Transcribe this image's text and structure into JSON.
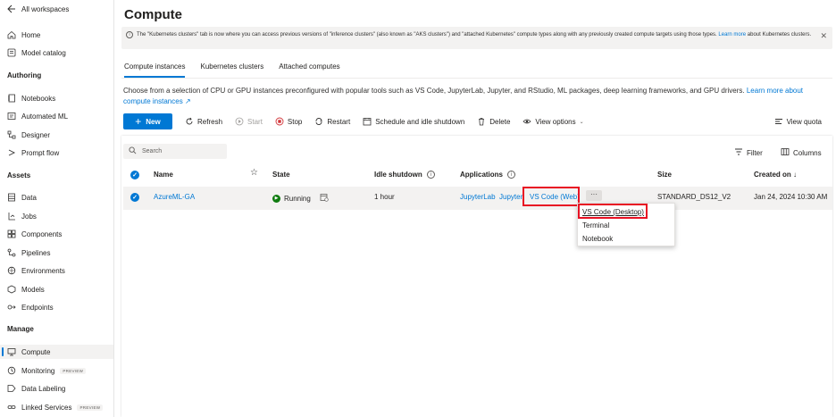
{
  "sidebar": {
    "back_label": "All workspaces",
    "top_items": [
      {
        "label": "Home",
        "icon": "home-icon"
      },
      {
        "label": "Model catalog",
        "icon": "catalog-icon"
      }
    ],
    "sections": [
      {
        "title": "Authoring",
        "items": [
          {
            "label": "Notebooks",
            "icon": "notebook-icon"
          },
          {
            "label": "Automated ML",
            "icon": "automl-icon"
          },
          {
            "label": "Designer",
            "icon": "designer-icon"
          },
          {
            "label": "Prompt flow",
            "icon": "promptflow-icon"
          }
        ]
      },
      {
        "title": "Assets",
        "items": [
          {
            "label": "Data",
            "icon": "data-icon"
          },
          {
            "label": "Jobs",
            "icon": "jobs-icon"
          },
          {
            "label": "Components",
            "icon": "components-icon"
          },
          {
            "label": "Pipelines",
            "icon": "pipelines-icon"
          },
          {
            "label": "Environments",
            "icon": "environments-icon"
          },
          {
            "label": "Models",
            "icon": "models-icon"
          },
          {
            "label": "Endpoints",
            "icon": "endpoints-icon"
          }
        ]
      },
      {
        "title": "Manage",
        "items": [
          {
            "label": "Compute",
            "icon": "compute-icon",
            "active": true
          },
          {
            "label": "Monitoring",
            "icon": "monitoring-icon",
            "badge": "PREVIEW"
          },
          {
            "label": "Data Labeling",
            "icon": "labeling-icon"
          },
          {
            "label": "Linked Services",
            "icon": "linked-icon",
            "badge": "PREVIEW"
          }
        ]
      }
    ]
  },
  "page": {
    "title": "Compute",
    "info_text": "The \"Kubernetes clusters\" tab is now where you can access previous versions of \"inference clusters\" (also known as \"AKS clusters\") and \"attached Kubernetes\" compute types along with any previously created compute targets using those types.",
    "info_link_a": "Learn",
    "info_link_b": "more",
    "info_text_end": "about Kubernetes clusters.",
    "tabs": [
      "Compute instances",
      "Kubernetes clusters",
      "Attached computes"
    ],
    "description": "Choose from a selection of CPU or GPU instances preconfigured with popular tools such as VS Code, JupyterLab, Jupyter, and RStudio, ML packages, deep learning frameworks, and GPU drivers.",
    "description_link": "Learn more about compute instances"
  },
  "toolbar": {
    "new": "New",
    "refresh": "Refresh",
    "start": "Start",
    "stop": "Stop",
    "restart": "Restart",
    "schedule": "Schedule and idle shutdown",
    "delete": "Delete",
    "view_options": "View options",
    "view_quota": "View quota"
  },
  "table": {
    "search_placeholder": "Search",
    "filter": "Filter",
    "columns": "Columns",
    "headers": {
      "name": "Name",
      "state": "State",
      "idle": "Idle shutdown",
      "applications": "Applications",
      "size": "Size",
      "created": "Created on ↓"
    },
    "row": {
      "name": "AzureML-GA",
      "state": "Running",
      "idle": "1 hour",
      "app1": "JupyterLab",
      "app2": "Jupyter",
      "app3": "VS Code (Web)",
      "more": "···",
      "size": "STANDARD_DS12_V2",
      "created": "Jan 24, 2024 10:30 AM"
    }
  },
  "context_menu": {
    "items": [
      "VS Code (Desktop)",
      "Terminal",
      "Notebook"
    ]
  },
  "colors": {
    "accent": "#0078d4",
    "running": "#107c10",
    "highlight": "#e81123"
  }
}
